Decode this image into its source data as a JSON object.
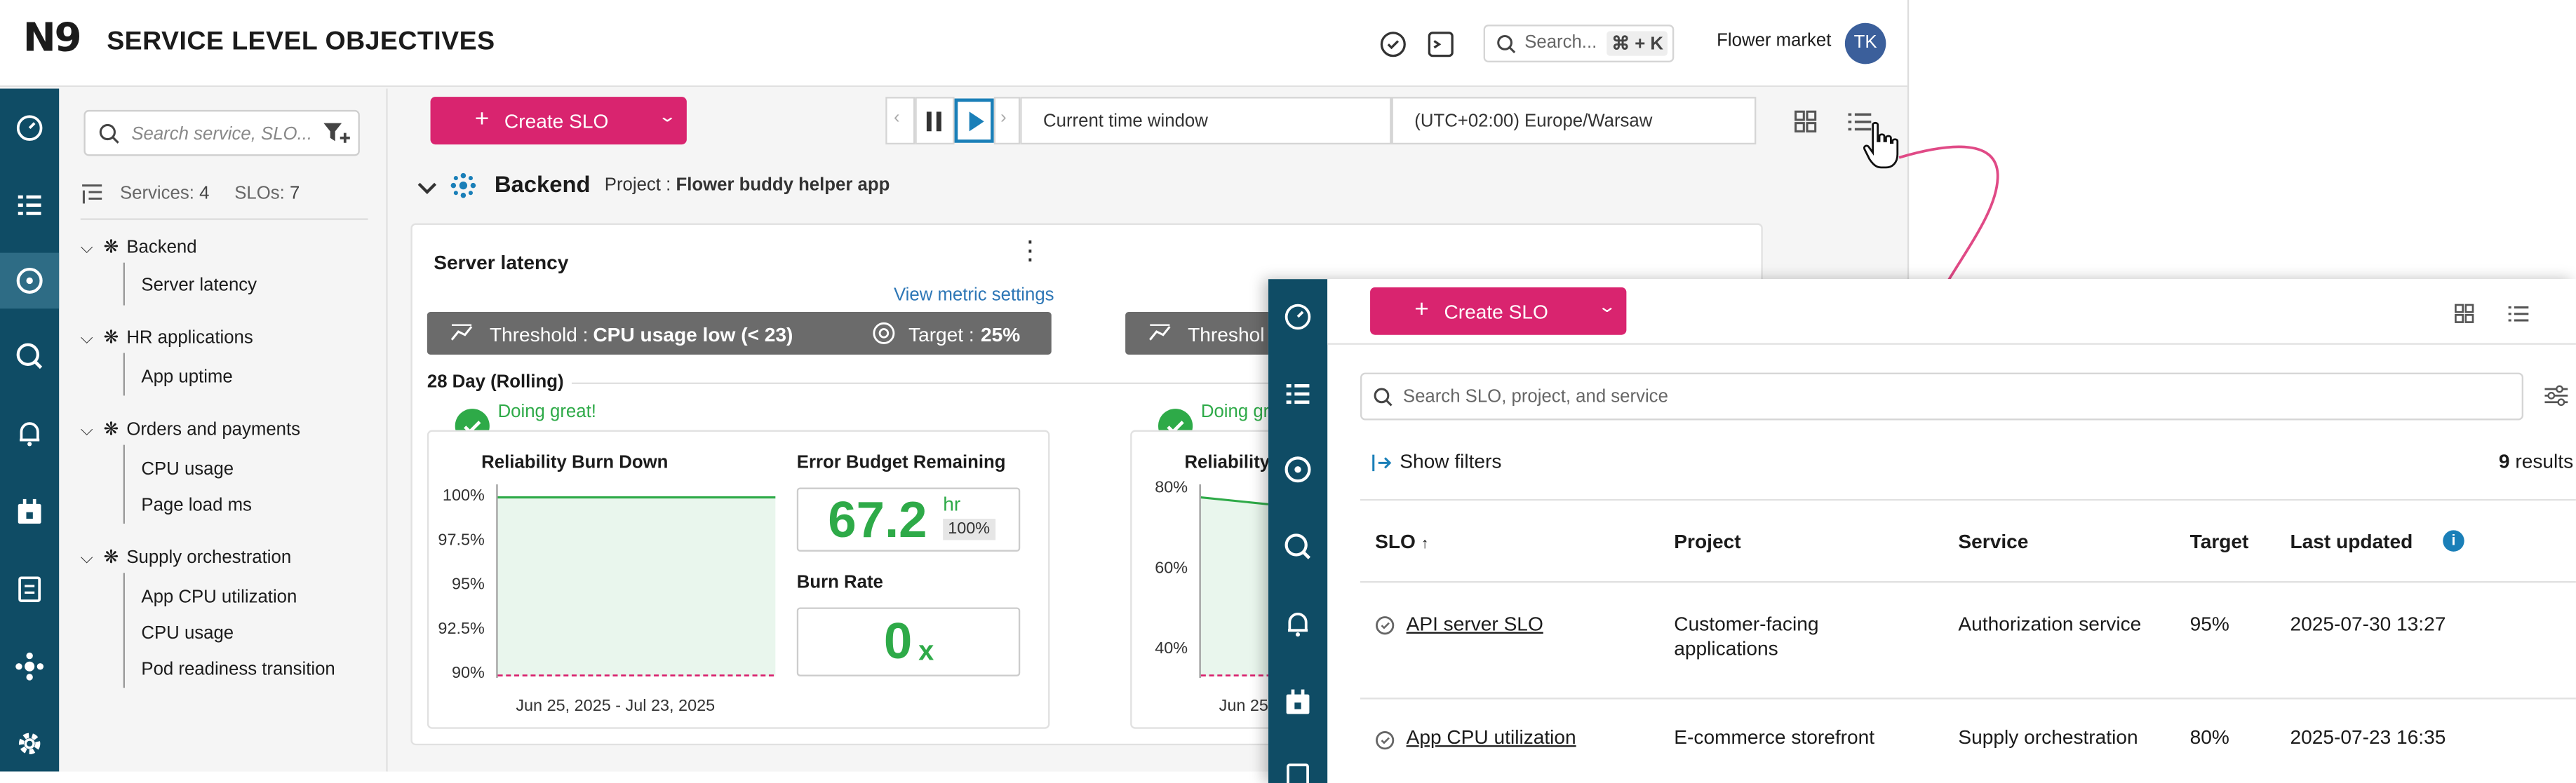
{
  "app": {
    "logo": "N9",
    "title": "SERVICE LEVEL OBJECTIVES",
    "search_placeholder": "Search...",
    "search_shortcut": "⌘ + K",
    "organization": "Flower market",
    "avatar_initials": "TK"
  },
  "sidebar_rail_icons": [
    "dashboard-icon",
    "list-icon",
    "slo-icon",
    "query-icon",
    "bell-icon",
    "calendar-icon",
    "report-icon",
    "integrations-icon",
    "settings-icon"
  ],
  "tree": {
    "search_placeholder": "Search service, SLO...",
    "services_label": "Services:",
    "services_count": "4",
    "slos_label": "SLOs:",
    "slos_count": "7",
    "groups": [
      {
        "name": "Backend",
        "items": [
          "Server latency"
        ]
      },
      {
        "name": "HR applications",
        "items": [
          "App uptime"
        ]
      },
      {
        "name": "Orders and payments",
        "items": [
          "CPU usage",
          "Page load ms"
        ]
      },
      {
        "name": "Supply orchestration",
        "items": [
          "App CPU utilization",
          "CPU usage",
          "Pod readiness transition"
        ]
      }
    ]
  },
  "toolbar": {
    "create_label": "Create SLO",
    "time_window": "Current time window",
    "timezone": "(UTC+02:00) Europe/Warsaw"
  },
  "group": {
    "name": "Backend",
    "project_label": "Project :",
    "project_value": "Flower buddy helper app"
  },
  "card": {
    "title": "Server latency",
    "view_metric": "View metric settings",
    "threshold_label": "Threshold :",
    "threshold_value": "CPU usage low (< 23)",
    "target_label": "Target :",
    "target_value": "25%",
    "second_threshold_label": "Threshol",
    "window": "28 Day (Rolling)",
    "status": "Doing great!",
    "status2": "Doing gr",
    "burndown_title": "Reliability Burn Down",
    "burndown_yticks": [
      "100%",
      "97.5%",
      "95%",
      "92.5%",
      "90%"
    ],
    "burndown_range": "Jun 25, 2025 - Jul 23, 2025",
    "burndown_value": 100,
    "burndown_target": 90,
    "eb_title": "Error Budget Remaining",
    "eb_value": "67.2",
    "eb_unit": "hr",
    "eb_pct": "100%",
    "burn_rate_title": "Burn Rate",
    "burn_rate_value": "0",
    "burn_rate_unit": "x",
    "second_title": "Reliability",
    "second_yticks": [
      "80%",
      "60%",
      "40%"
    ],
    "second_range": "Jun 25"
  },
  "overlay": {
    "create_label": "Create SLO",
    "search_placeholder": "Search SLO, project, and service",
    "show_filters": "Show filters",
    "results_count": "9",
    "results_label": "results",
    "columns": [
      "SLO",
      "Project",
      "Service",
      "Target",
      "Last updated"
    ],
    "rows": [
      {
        "slo": "API server SLO",
        "project_line1": "Customer-facing",
        "project_line2": "applications",
        "service": "Authorization service",
        "target": "95%",
        "updated": "2025-07-30 13:27"
      },
      {
        "slo": "App CPU utilization",
        "project_line1": "E-commerce storefront",
        "project_line2": "",
        "service": "Supply orchestration",
        "target": "80%",
        "updated": "2025-07-23 16:35"
      }
    ]
  },
  "colors": {
    "brand_pink": "#d9246f",
    "rail": "#0f4c65",
    "success": "#2eaa48",
    "link": "#2e77b6",
    "connector": "#e04a86"
  }
}
